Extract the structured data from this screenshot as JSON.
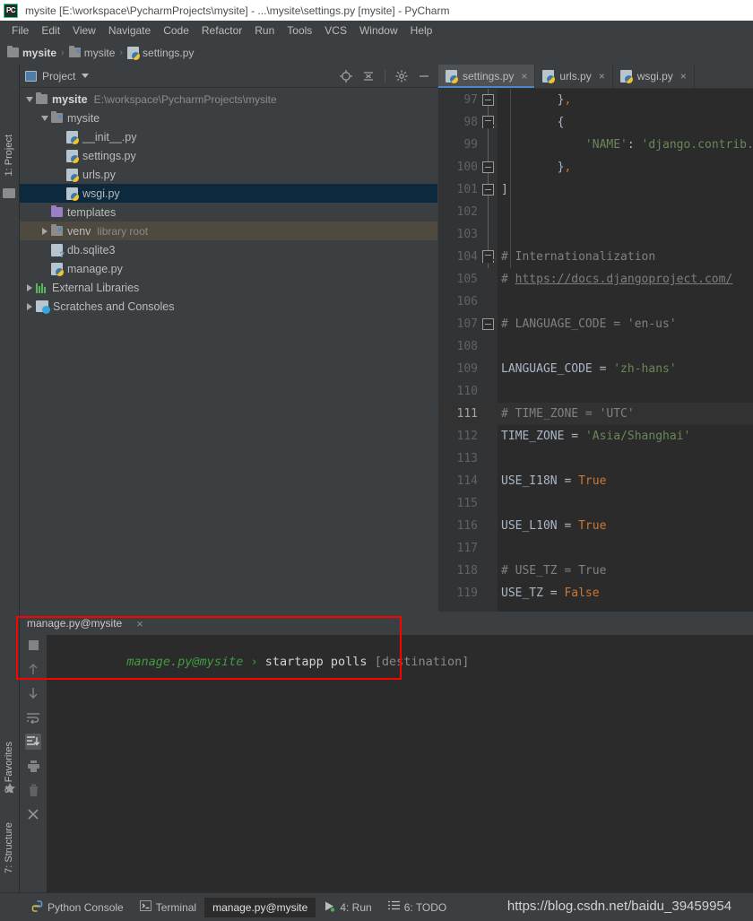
{
  "window": {
    "logo": "pycharm-logo",
    "title": "mysite [E:\\workspace\\PycharmProjects\\mysite] - ...\\mysite\\settings.py [mysite] - PyCharm"
  },
  "menu": {
    "items": [
      {
        "label": "File"
      },
      {
        "label": "Edit"
      },
      {
        "label": "View"
      },
      {
        "label": "Navigate"
      },
      {
        "label": "Code"
      },
      {
        "label": "Refactor"
      },
      {
        "label": "Run"
      },
      {
        "label": "Tools"
      },
      {
        "label": "VCS"
      },
      {
        "label": "Window"
      },
      {
        "label": "Help"
      }
    ]
  },
  "breadcrumb": {
    "separator": "›",
    "items": [
      {
        "label": "mysite",
        "icon": "folder-icon",
        "bold": true
      },
      {
        "label": "mysite",
        "icon": "module-folder-icon",
        "bold": false
      },
      {
        "label": "settings.py",
        "icon": "python-file-icon",
        "bold": false
      }
    ]
  },
  "left_strip": {
    "project_label": "1: Project",
    "favorites_label": "2: Favorites",
    "structure_label": "7: Structure"
  },
  "project_panel": {
    "title": "Project",
    "tools": [
      {
        "name": "locate-icon",
        "tooltip": "Select Opened File"
      },
      {
        "name": "collapse-all-icon",
        "tooltip": "Collapse All"
      },
      {
        "name": "gear-icon",
        "tooltip": "Settings"
      },
      {
        "name": "minimize-icon",
        "tooltip": "Hide"
      }
    ],
    "tree": [
      {
        "label": "mysite",
        "path": "E:\\workspace\\PycharmProjects\\mysite",
        "icon": "folder-icon",
        "indent": 0,
        "arrow": "down",
        "bold": true,
        "state": "normal"
      },
      {
        "label": "mysite",
        "path": "",
        "icon": "module-folder-icon",
        "indent": 1,
        "arrow": "down",
        "bold": false,
        "state": "normal"
      },
      {
        "label": "__init__.py",
        "path": "",
        "icon": "python-file-icon",
        "indent": 2,
        "arrow": "none",
        "bold": false,
        "state": "normal"
      },
      {
        "label": "settings.py",
        "path": "",
        "icon": "python-file-icon",
        "indent": 2,
        "arrow": "none",
        "bold": false,
        "state": "normal"
      },
      {
        "label": "urls.py",
        "path": "",
        "icon": "python-file-icon",
        "indent": 2,
        "arrow": "none",
        "bold": false,
        "state": "normal"
      },
      {
        "label": "wsgi.py",
        "path": "",
        "icon": "python-file-icon",
        "indent": 2,
        "arrow": "none",
        "bold": false,
        "state": "selected"
      },
      {
        "label": "templates",
        "path": "",
        "icon": "folder-purple-icon",
        "indent": 1,
        "arrow": "none",
        "bold": false,
        "state": "normal"
      },
      {
        "label": "venv",
        "path": "library root",
        "icon": "module-folder-icon",
        "indent": 1,
        "arrow": "right",
        "bold": false,
        "state": "highlight"
      },
      {
        "label": "db.sqlite3",
        "path": "",
        "icon": "db-file-icon",
        "indent": 1,
        "arrow": "none",
        "bold": false,
        "state": "normal"
      },
      {
        "label": "manage.py",
        "path": "",
        "icon": "python-file-icon",
        "indent": 1,
        "arrow": "none",
        "bold": false,
        "state": "normal"
      },
      {
        "label": "External Libraries",
        "path": "",
        "icon": "libraries-icon",
        "indent": 0,
        "arrow": "right",
        "bold": false,
        "state": "normal"
      },
      {
        "label": "Scratches and Consoles",
        "path": "",
        "icon": "scratches-icon",
        "indent": 0,
        "arrow": "right",
        "bold": false,
        "state": "normal"
      }
    ]
  },
  "editor": {
    "tabs": [
      {
        "label": "settings.py",
        "icon": "python-file-icon",
        "close": "×",
        "active": true
      },
      {
        "label": "urls.py",
        "icon": "python-file-icon",
        "close": "×",
        "active": false
      },
      {
        "label": "wsgi.py",
        "icon": "python-file-icon",
        "close": "×",
        "active": false
      }
    ],
    "current_line": 111,
    "lines": [
      {
        "no": "97",
        "fold": "sq",
        "text": "        },",
        "tokens": [
          {
            "t": "        }",
            "c": "def"
          },
          {
            "t": ",",
            "c": "pun"
          }
        ]
      },
      {
        "no": "98",
        "fold": "arrow",
        "text": "        {",
        "tokens": [
          {
            "t": "        {",
            "c": "def"
          }
        ]
      },
      {
        "no": "99",
        "fold": "none",
        "text": "            'NAME': 'django.contrib.a",
        "tokens": [
          {
            "t": "            ",
            "c": "def"
          },
          {
            "t": "'NAME'",
            "c": "str"
          },
          {
            "t": ":",
            "c": "def"
          },
          {
            "t": " ",
            "c": "def"
          },
          {
            "t": "'django.contrib.a",
            "c": "str"
          }
        ]
      },
      {
        "no": "100",
        "fold": "sq",
        "text": "        },",
        "tokens": [
          {
            "t": "        }",
            "c": "def"
          },
          {
            "t": ",",
            "c": "pun"
          }
        ]
      },
      {
        "no": "101",
        "fold": "sq",
        "text": "]",
        "tokens": [
          {
            "t": "]",
            "c": "def"
          }
        ]
      },
      {
        "no": "102",
        "fold": "none",
        "text": "",
        "tokens": []
      },
      {
        "no": "103",
        "fold": "none",
        "text": "",
        "tokens": []
      },
      {
        "no": "104",
        "fold": "arrow",
        "text": "# Internationalization",
        "tokens": [
          {
            "t": "# Internationalization",
            "c": "cmt"
          }
        ]
      },
      {
        "no": "105",
        "fold": "none",
        "text": "# https://docs.djangoproject.com/",
        "tokens": [
          {
            "t": "# ",
            "c": "cmt"
          },
          {
            "t": "https://docs.djangoproject.com/",
            "c": "lnk"
          }
        ]
      },
      {
        "no": "106",
        "fold": "none",
        "text": "",
        "tokens": []
      },
      {
        "no": "107",
        "fold": "sq",
        "text": "# LANGUAGE_CODE = 'en-us'",
        "tokens": [
          {
            "t": "# LANGUAGE_CODE = 'en-us'",
            "c": "cmt"
          }
        ]
      },
      {
        "no": "108",
        "fold": "none",
        "text": "",
        "tokens": []
      },
      {
        "no": "109",
        "fold": "none",
        "text": "LANGUAGE_CODE = 'zh-hans'",
        "tokens": [
          {
            "t": "LANGUAGE_CODE ",
            "c": "def"
          },
          {
            "t": "= ",
            "c": "def"
          },
          {
            "t": "'zh-hans'",
            "c": "str"
          }
        ]
      },
      {
        "no": "110",
        "fold": "none",
        "text": "",
        "tokens": []
      },
      {
        "no": "111",
        "fold": "none",
        "text": "# TIME_ZONE = 'UTC'",
        "tokens": [
          {
            "t": "# TIME_ZONE = 'UTC'",
            "c": "cmt"
          }
        ]
      },
      {
        "no": "112",
        "fold": "none",
        "text": "TIME_ZONE = 'Asia/Shanghai'",
        "tokens": [
          {
            "t": "TIME_ZONE ",
            "c": "def"
          },
          {
            "t": "= ",
            "c": "def"
          },
          {
            "t": "'Asia/Shanghai'",
            "c": "str"
          }
        ]
      },
      {
        "no": "113",
        "fold": "none",
        "text": "",
        "tokens": []
      },
      {
        "no": "114",
        "fold": "none",
        "text": "USE_I18N = True",
        "tokens": [
          {
            "t": "USE_I18N ",
            "c": "def"
          },
          {
            "t": "= ",
            "c": "def"
          },
          {
            "t": "True",
            "c": "kw"
          }
        ]
      },
      {
        "no": "115",
        "fold": "none",
        "text": "",
        "tokens": []
      },
      {
        "no": "116",
        "fold": "none",
        "text": "USE_L10N = True",
        "tokens": [
          {
            "t": "USE_L10N ",
            "c": "def"
          },
          {
            "t": "= ",
            "c": "def"
          },
          {
            "t": "True",
            "c": "kw"
          }
        ]
      },
      {
        "no": "117",
        "fold": "none",
        "text": "",
        "tokens": []
      },
      {
        "no": "118",
        "fold": "none",
        "text": "# USE_TZ = True",
        "tokens": [
          {
            "t": "# USE_TZ = True",
            "c": "cmt"
          }
        ]
      },
      {
        "no": "119",
        "fold": "none",
        "text": "USE_TZ = False",
        "tokens": [
          {
            "t": "USE_TZ ",
            "c": "def"
          },
          {
            "t": "= ",
            "c": "def"
          },
          {
            "t": "False",
            "c": "kw"
          }
        ]
      }
    ]
  },
  "console": {
    "tab_label": "manage.py@mysite",
    "tab_close": "×",
    "toolbar": [
      {
        "name": "stop-icon",
        "active": false
      },
      {
        "name": "up-arrow-icon",
        "active": false
      },
      {
        "name": "down-arrow-icon",
        "active": false
      },
      {
        "name": "soft-wrap-icon",
        "active": false
      },
      {
        "name": "scroll-to-end-icon",
        "active": true
      },
      {
        "name": "print-icon",
        "active": false
      },
      {
        "name": "trash-icon",
        "active": false
      },
      {
        "name": "close-icon",
        "active": false
      }
    ],
    "prompt": "manage.py@mysite",
    "arrow": "›",
    "command": "startapp polls",
    "hint": "[destination]"
  },
  "statusbar": {
    "items": [
      {
        "label": "Python Console",
        "icon": "python-console-icon",
        "active": false
      },
      {
        "label": "Terminal",
        "icon": "terminal-icon",
        "active": false
      },
      {
        "label": "manage.py@mysite",
        "icon": "none",
        "active": true
      },
      {
        "label": "4: Run",
        "icon": "run-icon",
        "active": false
      },
      {
        "label": "6: TODO",
        "icon": "todo-icon",
        "active": false
      }
    ],
    "watermark": "https://blog.csdn.net/baidu_39459954"
  },
  "colors": {
    "accent": "#4a88c7",
    "selection": "#0d293e",
    "highlight": "#4e4a3f",
    "red_box": "#ff0000",
    "panel_bg": "#3c3f41",
    "editor_bg": "#2b2b2b",
    "string": "#6a8759",
    "keyword": "#cc7832",
    "comment": "#808080"
  }
}
